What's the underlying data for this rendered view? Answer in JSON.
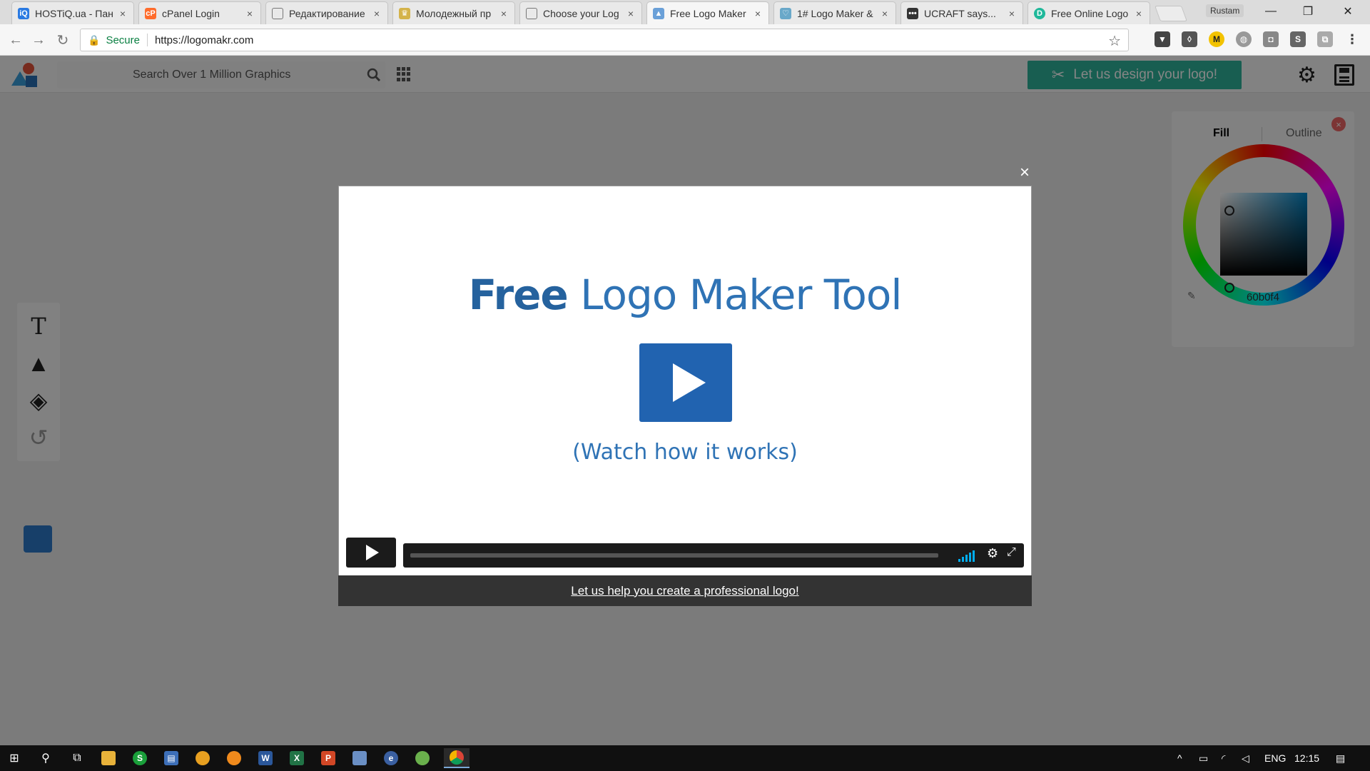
{
  "browser": {
    "tabs": [
      {
        "title": "HOSTiQ.ua - Пан",
        "favicon": "hostiq-favicon",
        "color": "#2a7ae2",
        "glyph": "iQ"
      },
      {
        "title": "cPanel Login",
        "favicon": "cpanel-favicon",
        "color": "#ff6c2c",
        "glyph": "cP"
      },
      {
        "title": "Редактирование",
        "favicon": "document-favicon",
        "color": "#888888",
        "glyph": ""
      },
      {
        "title": "Молодежный пр",
        "favicon": "crown-favicon",
        "color": "#d4b34a",
        "glyph": "♛"
      },
      {
        "title": "Choose your Log",
        "favicon": "document-favicon",
        "color": "#888888",
        "glyph": ""
      },
      {
        "title": "Free Logo Maker",
        "favicon": "logomakr-favicon",
        "color": "#6aa0d8",
        "glyph": "▲"
      },
      {
        "title": "1# Logo Maker &",
        "favicon": "shield-favicon",
        "color": "#69a8c9",
        "glyph": "♡"
      },
      {
        "title": "UCRAFT says...",
        "favicon": "dots-favicon",
        "color": "#333333",
        "glyph": "•••"
      },
      {
        "title": "Free Online Logo",
        "favicon": "d-favicon",
        "color": "#1fb89a",
        "glyph": "D"
      }
    ],
    "tab_close": "×",
    "profile_name": "Rustam",
    "window_controls": {
      "minimize": "—",
      "restore": "❐",
      "close": "✕"
    },
    "secure_label": "Secure",
    "url": "https://logomakr.com"
  },
  "app": {
    "search_placeholder": "Search Over 1 Million Graphics",
    "design_button": "Let us design your logo!",
    "tools": [
      "T",
      "▲",
      "◈",
      "↺"
    ],
    "color_panel": {
      "fill_tab": "Fill",
      "outline_tab": "Outline",
      "hex": "60b0f4",
      "close_glyph": "×"
    }
  },
  "modal": {
    "close_glyph": "×",
    "title_bold": "Free",
    "title_rest": " Logo Maker Tool",
    "subtitle": "(Watch how it works)",
    "footer_link": "Let us help you create a professional logo!"
  },
  "taskbar": {
    "language": "ENG",
    "time": "12:15"
  },
  "colors": {
    "accent": "#2fb59c",
    "brand_blue": "#2163b0",
    "title_blue": "#2f73b5"
  }
}
